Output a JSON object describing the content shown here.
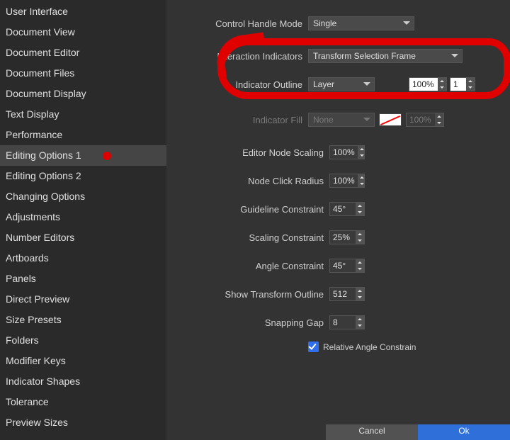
{
  "sidebar": {
    "items": [
      {
        "label": "User Interface"
      },
      {
        "label": "Document View"
      },
      {
        "label": "Document Editor"
      },
      {
        "label": "Document Files"
      },
      {
        "label": "Document Display"
      },
      {
        "label": "Text Display"
      },
      {
        "label": "Performance"
      },
      {
        "label": "Editing Options 1",
        "selected": true
      },
      {
        "label": "Editing Options 2"
      },
      {
        "label": "Changing Options"
      },
      {
        "label": "Adjustments"
      },
      {
        "label": "Number Editors"
      },
      {
        "label": "Artboards"
      },
      {
        "label": "Panels"
      },
      {
        "label": "Direct Preview"
      },
      {
        "label": "Size Presets"
      },
      {
        "label": "Folders"
      },
      {
        "label": "Modifier Keys"
      },
      {
        "label": "Indicator Shapes"
      },
      {
        "label": "Tolerance"
      },
      {
        "label": "Preview Sizes"
      }
    ]
  },
  "settings": {
    "control_handle_mode": {
      "label": "Control Handle Mode",
      "value": "Single"
    },
    "interaction_indicators": {
      "label": "Interaction Indicators",
      "value": "Transform Selection Frame"
    },
    "indicator_outline": {
      "label": "Indicator Outline",
      "value": "Layer",
      "opacity": "100%",
      "width": "1"
    },
    "indicator_fill": {
      "label": "Indicator Fill",
      "value": "None",
      "opacity": "100%"
    },
    "editor_node_scaling": {
      "label": "Editor Node Scaling",
      "value": "100%"
    },
    "node_click_radius": {
      "label": "Node Click Radius",
      "value": "100%"
    },
    "guideline_constraint": {
      "label": "Guideline Constraint",
      "value": "45°"
    },
    "scaling_constraint": {
      "label": "Scaling Constraint",
      "value": "25%"
    },
    "angle_constraint": {
      "label": "Angle Constraint",
      "value": "45°"
    },
    "show_transform_outline": {
      "label": "Show Transform Outline",
      "value": "512"
    },
    "snapping_gap": {
      "label": "Snapping Gap",
      "value": "8"
    },
    "relative_angle_constrain": {
      "label": "Relative Angle Constrain",
      "checked": true
    }
  },
  "buttons": {
    "cancel": "Cancel",
    "ok": "Ok"
  }
}
